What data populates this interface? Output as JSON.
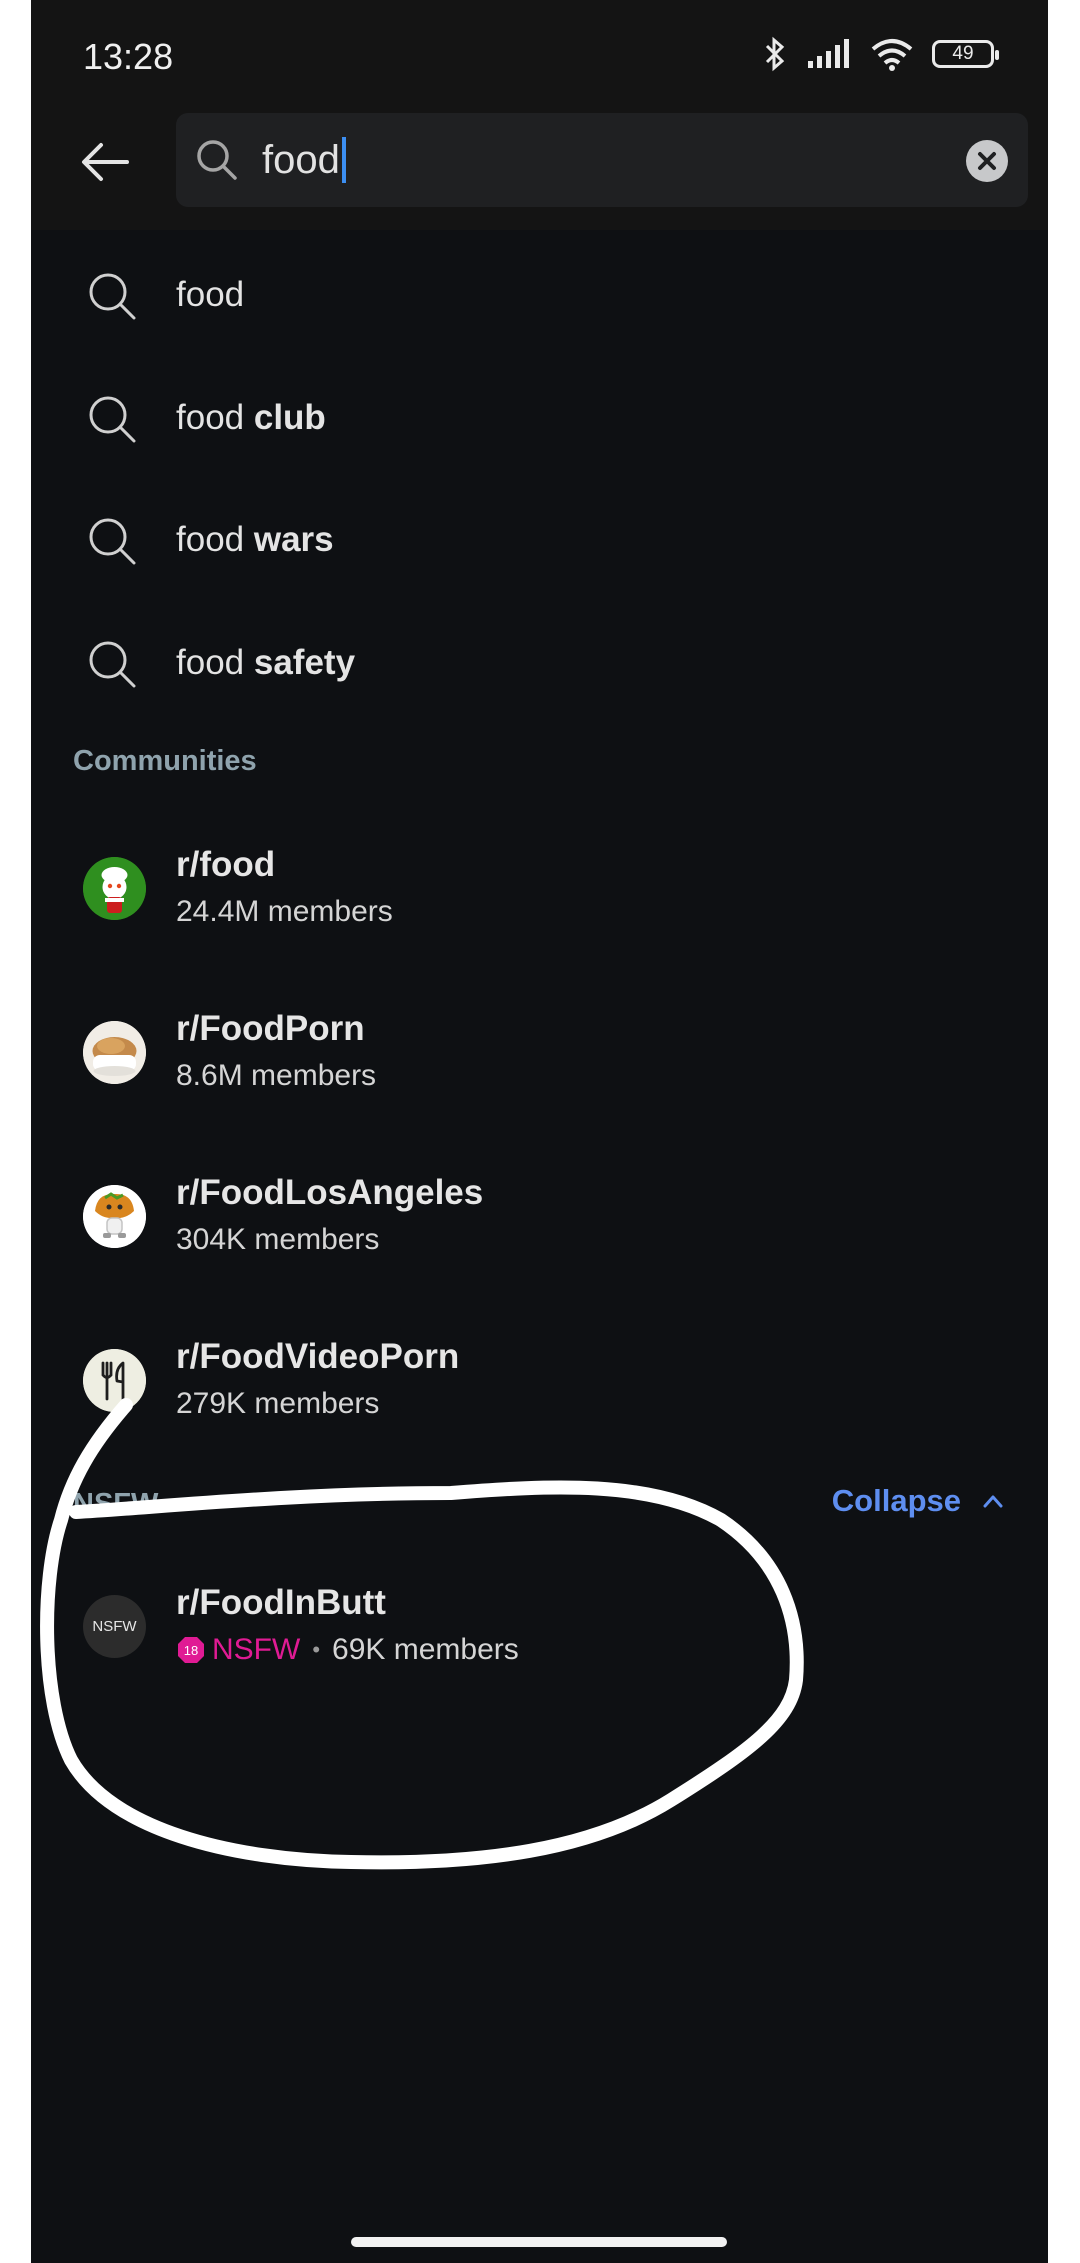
{
  "status_bar": {
    "time": "13:28",
    "battery": "49"
  },
  "search": {
    "value": "food"
  },
  "suggestions": [
    {
      "prefix": "food",
      "suffix": ""
    },
    {
      "prefix": "food ",
      "suffix": "club"
    },
    {
      "prefix": "food ",
      "suffix": "wars"
    },
    {
      "prefix": "food ",
      "suffix": "safety"
    }
  ],
  "communities_title": "Communities",
  "communities": [
    {
      "name": "r/food",
      "members": "24.4M members"
    },
    {
      "name": "r/FoodPorn",
      "members": "8.6M members"
    },
    {
      "name": "r/FoodLosAngeles",
      "members": "304K members"
    },
    {
      "name": "r/FoodVideoPorn",
      "members": "279K members"
    }
  ],
  "nsfw_section": {
    "title": "NSFW",
    "collapse_label": "Collapse",
    "community": {
      "avatar_text": "NSFW",
      "badge_number": "18",
      "name": "r/FoodInButt",
      "nsfw_label": "NSFW",
      "separator": "•",
      "members": "69K members"
    }
  },
  "colors": {
    "background": "#0e1013",
    "accent_blue": "#5e8ef0",
    "nsfw_pink": "#e01b94",
    "caret": "#3c8ff2"
  },
  "icons": [
    "back-arrow-icon",
    "search-icon",
    "clear-icon",
    "chevron-up-icon",
    "bluetooth-icon",
    "signal-icon",
    "wifi-icon",
    "battery-icon"
  ]
}
